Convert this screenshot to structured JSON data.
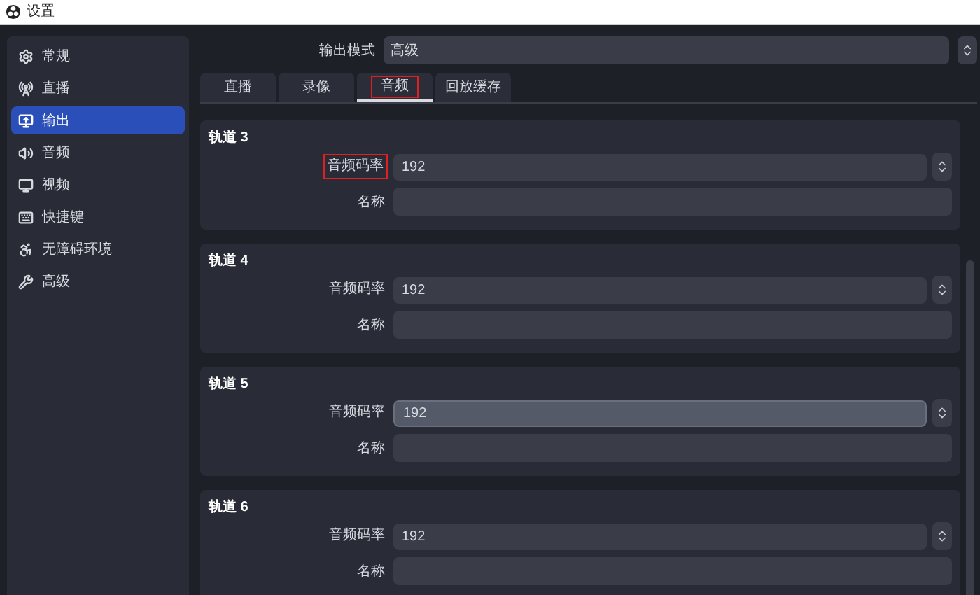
{
  "window": {
    "title": "设置"
  },
  "sidebar": {
    "items": [
      {
        "label": "常规",
        "selected": false
      },
      {
        "label": "直播",
        "selected": false
      },
      {
        "label": "输出",
        "selected": true
      },
      {
        "label": "音频",
        "selected": false
      },
      {
        "label": "视频",
        "selected": false
      },
      {
        "label": "快捷键",
        "selected": false
      },
      {
        "label": "无障碍环境",
        "selected": false
      },
      {
        "label": "高级",
        "selected": false
      }
    ]
  },
  "output_mode": {
    "label": "输出模式",
    "value": "高级"
  },
  "tabs": [
    {
      "label": "直播",
      "selected": false,
      "highlighted": false
    },
    {
      "label": "录像",
      "selected": false,
      "highlighted": false
    },
    {
      "label": "音频",
      "selected": true,
      "highlighted": true
    },
    {
      "label": "回放缓存",
      "selected": false,
      "highlighted": false
    }
  ],
  "tracks": [
    {
      "title": "轨道 3",
      "bitrate_label": "音频码率",
      "bitrate_label_highlighted": true,
      "bitrate": "192",
      "hovered": false,
      "name_label": "名称"
    },
    {
      "title": "轨道 4",
      "bitrate_label": "音频码率",
      "bitrate_label_highlighted": false,
      "bitrate": "192",
      "hovered": false,
      "name_label": "名称"
    },
    {
      "title": "轨道 5",
      "bitrate_label": "音频码率",
      "bitrate_label_highlighted": false,
      "bitrate": "192",
      "hovered": true,
      "name_label": "名称"
    },
    {
      "title": "轨道 6",
      "bitrate_label": "音频码率",
      "bitrate_label_highlighted": false,
      "bitrate": "192",
      "hovered": false,
      "name_label": "名称"
    }
  ]
}
